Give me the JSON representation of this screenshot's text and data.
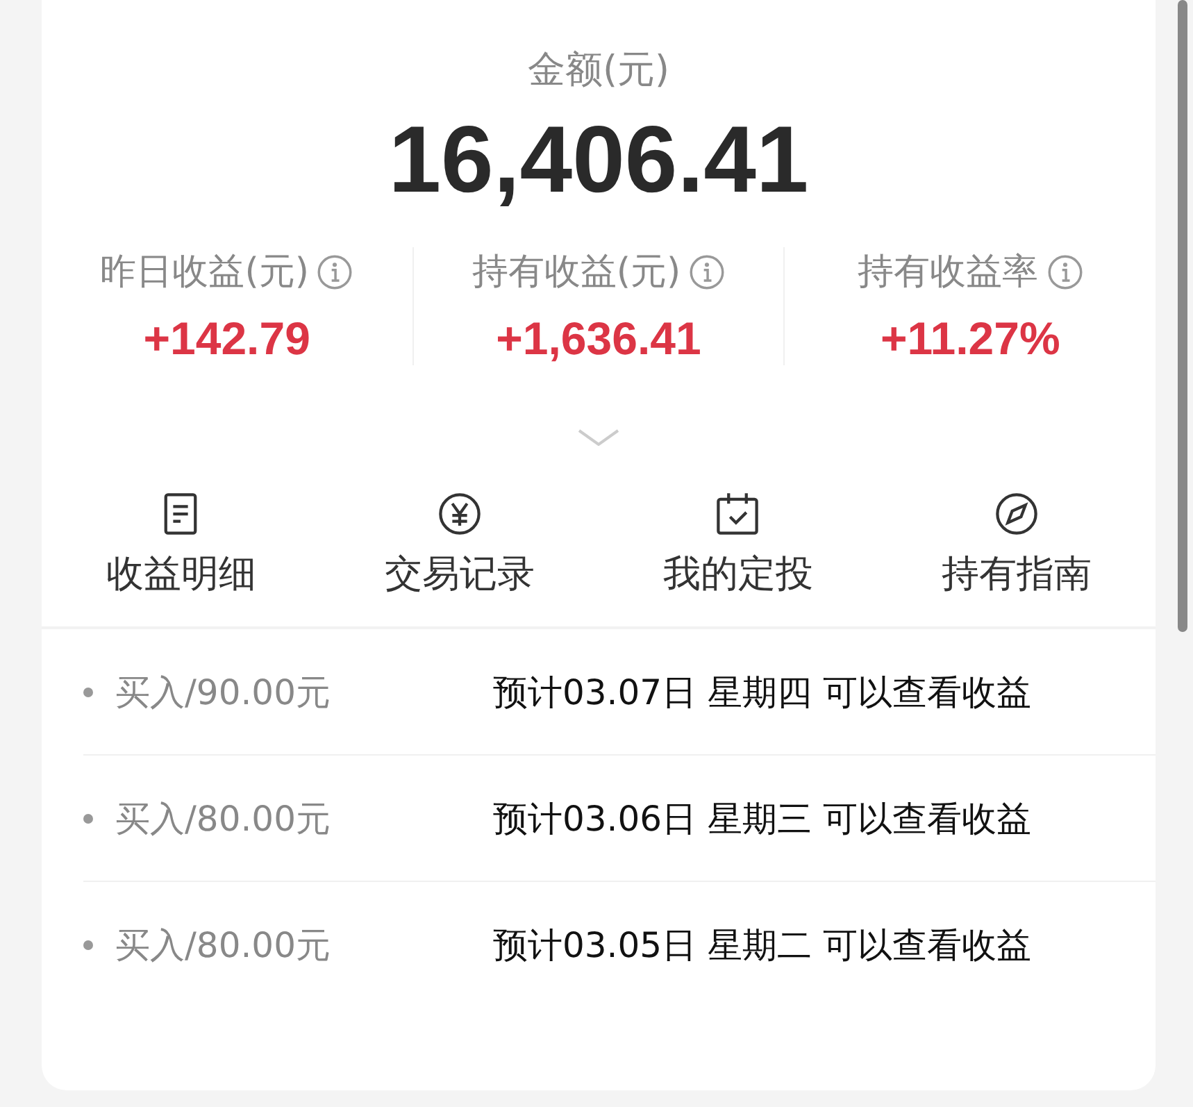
{
  "balance": {
    "label": "金额(元)",
    "value": "16,406.41"
  },
  "stats": [
    {
      "label": "昨日收益(元)",
      "value": "+142.79"
    },
    {
      "label": "持有收益(元)",
      "value": "+1,636.41"
    },
    {
      "label": "持有收益率",
      "value": "+11.27%"
    }
  ],
  "actions": [
    {
      "kind": "document",
      "label": "收益明细"
    },
    {
      "kind": "yen",
      "label": "交易记录"
    },
    {
      "kind": "calendar",
      "label": "我的定投"
    },
    {
      "kind": "compass",
      "label": "持有指南"
    }
  ],
  "records": [
    {
      "amount": "买入/90.00元",
      "note": "预计03.07日 星期四 可以查看收益"
    },
    {
      "amount": "买入/80.00元",
      "note": "预计03.06日 星期三 可以查看收益"
    },
    {
      "amount": "买入/80.00元",
      "note": "预计03.05日 星期二 可以查看收益"
    }
  ]
}
